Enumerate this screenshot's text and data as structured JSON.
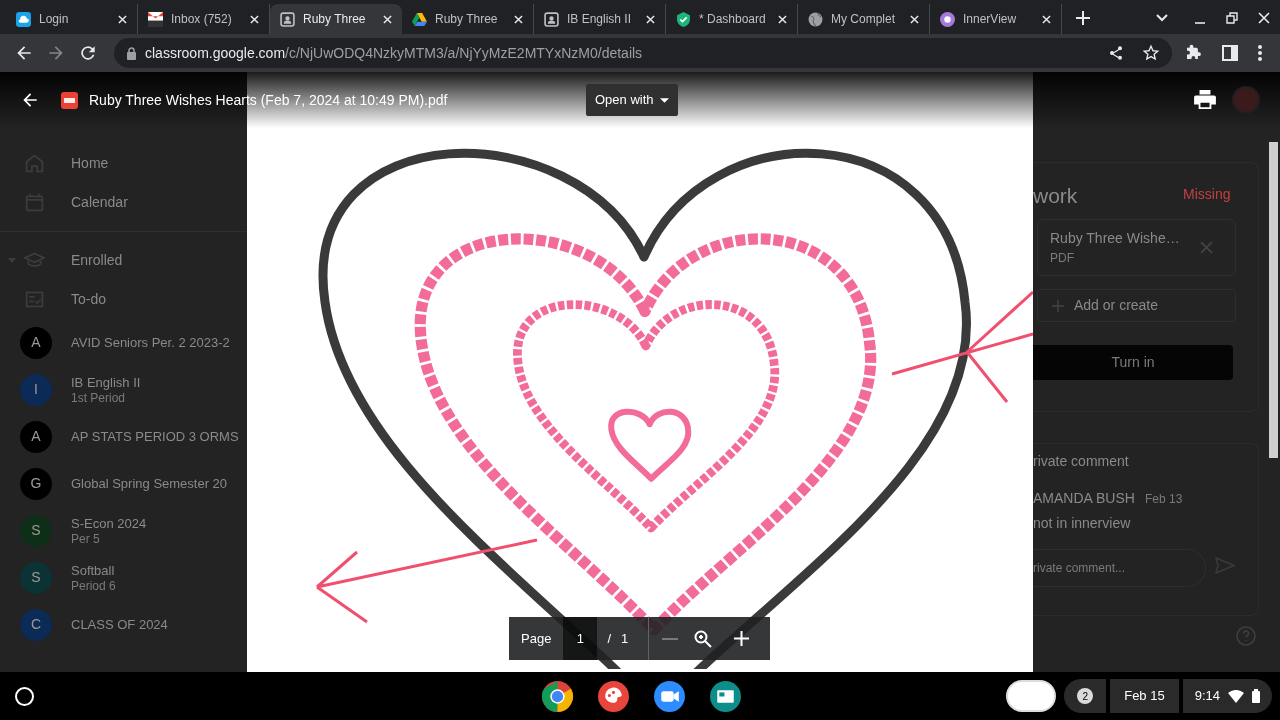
{
  "browser": {
    "tabs": [
      {
        "title": "Login",
        "selected": false
      },
      {
        "title": "Inbox (752)",
        "selected": false
      },
      {
        "title": "Ruby Three",
        "selected": true
      },
      {
        "title": "Ruby Three",
        "selected": false
      },
      {
        "title": "IB English II",
        "selected": false
      },
      {
        "title": "* Dashboard",
        "selected": false
      },
      {
        "title": "My Complet",
        "selected": false
      },
      {
        "title": "InnerView",
        "selected": false
      }
    ],
    "url": {
      "host": "classroom.google.com",
      "path": "/c/NjUwODQ4NzkyMTM3/a/NjYyMzE2MTYxNzM0/details"
    }
  },
  "sidebar": {
    "items": [
      {
        "kind": "nav",
        "label": "Home"
      },
      {
        "kind": "nav",
        "label": "Calendar"
      },
      {
        "kind": "section",
        "label": "Enrolled",
        "expanded": true
      },
      {
        "kind": "nav",
        "label": "To-do"
      },
      {
        "kind": "course",
        "label": "AVID Seniors Per. 2 2023-2",
        "letter": "A",
        "color": "#000000"
      },
      {
        "kind": "course",
        "label": "IB English II",
        "subtitle": "1st Period",
        "letter": "I",
        "color": "#0b2a55"
      },
      {
        "kind": "course",
        "label": "AP STATS PERIOD 3 ORMS",
        "letter": "A",
        "color": "#000000"
      },
      {
        "kind": "course",
        "label": "Global Spring Semester 20",
        "letter": "G",
        "color": "#000000"
      },
      {
        "kind": "course",
        "label": "S-Econ 2024",
        "subtitle": "Per 5",
        "letter": "S",
        "color": "#0d2e17"
      },
      {
        "kind": "course",
        "label": "Softball",
        "subtitle": "Period 6",
        "letter": "S",
        "color": "#0b3234"
      },
      {
        "kind": "course",
        "label": "CLASS OF 2024",
        "letter": "C",
        "color": "#0b2a55"
      }
    ]
  },
  "viewer": {
    "title": "Ruby Three Wishes Hearts (Feb 7, 2024 at 10:49 PM).pdf",
    "open_with": "Open with",
    "toolbar": {
      "label": "Page",
      "current": "1",
      "separator": "/",
      "total": "1"
    }
  },
  "work": {
    "heading": "work",
    "status": "Missing",
    "attachment": {
      "name": "Ruby Three Wishe…",
      "type": "PDF"
    },
    "add_button": "Add or create",
    "turn_in": "Turn in",
    "comments": {
      "heading": "rivate comment",
      "author": "AMANDA BUSH",
      "date": "Feb 13",
      "text": "not in innerview",
      "placeholder": "rivate comment..."
    }
  },
  "taskbar": {
    "notifications": "2",
    "date": "Feb 15",
    "time": "9:14"
  }
}
